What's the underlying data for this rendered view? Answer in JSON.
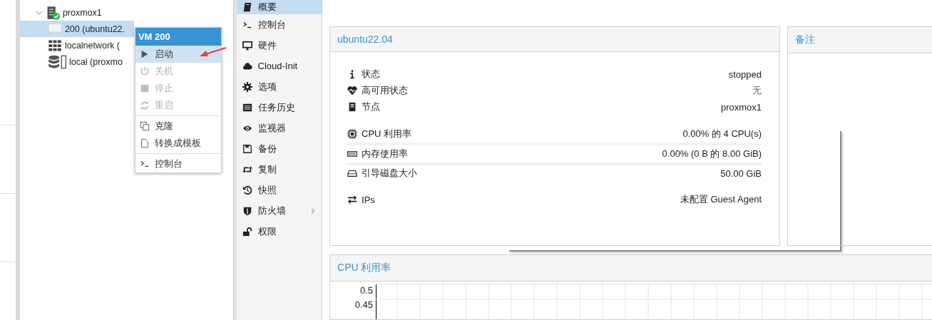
{
  "tree": [
    {
      "label": "proxmox1",
      "kind": "node",
      "expanded": true,
      "selected": false,
      "children": [
        {
          "label": "200 (ubuntu22.",
          "kind": "vm",
          "selected": true
        },
        {
          "label": "localnetwork (",
          "kind": "network",
          "selected": false
        },
        {
          "label": "local (proxmo",
          "kind": "storage",
          "selected": false
        }
      ]
    }
  ],
  "context_menu": {
    "title": "VM 200",
    "items": [
      {
        "kind": "play",
        "label": "启动",
        "disabled": false,
        "selected": true
      },
      {
        "kind": "power",
        "label": "关机",
        "disabled": true,
        "selected": false
      },
      {
        "kind": "stop",
        "label": "停止",
        "disabled": true,
        "selected": false
      },
      {
        "kind": "reload",
        "label": "重启",
        "disabled": true,
        "selected": false
      },
      {
        "kind": "separator"
      },
      {
        "kind": "clone",
        "label": "克隆",
        "disabled": false,
        "selected": false
      },
      {
        "kind": "file",
        "label": "转换成模板",
        "disabled": false,
        "selected": false
      },
      {
        "kind": "separator"
      },
      {
        "kind": "terminal",
        "label": "控制台",
        "disabled": false,
        "selected": false
      }
    ]
  },
  "nav": [
    {
      "label": "概要",
      "selected": true,
      "submenu": false
    },
    {
      "label": "控制台",
      "selected": false,
      "submenu": false
    },
    {
      "label": "硬件",
      "selected": false,
      "submenu": false
    },
    {
      "label": "Cloud-Init",
      "selected": false,
      "submenu": false
    },
    {
      "label": "选项",
      "selected": false,
      "submenu": false
    },
    {
      "label": "任务历史",
      "selected": false,
      "submenu": false
    },
    {
      "label": "监视器",
      "selected": false,
      "submenu": false
    },
    {
      "label": "备份",
      "selected": false,
      "submenu": false
    },
    {
      "label": "复制",
      "selected": false,
      "submenu": false
    },
    {
      "label": "快照",
      "selected": false,
      "submenu": false
    },
    {
      "label": "防火墙",
      "selected": false,
      "submenu": true
    },
    {
      "label": "权限",
      "selected": false,
      "submenu": false
    }
  ],
  "summary": {
    "title": "ubuntu22.04",
    "groups": [
      [
        {
          "kind": "info",
          "label": "状态",
          "value": "stopped",
          "muted": false
        },
        {
          "kind": "heartbeat",
          "label": "高可用状态",
          "value": "无",
          "muted": true
        },
        {
          "kind": "server",
          "label": "节点",
          "value": "proxmox1",
          "muted": false
        }
      ],
      [
        {
          "kind": "chip",
          "label": "CPU 利用率",
          "value": "0.00% 的 4 CPU(s)",
          "muted": false
        },
        {
          "kind": "memory",
          "label": "内存使用率",
          "value": "0.00% (0 B 的 8.00 GiB)",
          "muted": false
        },
        {
          "kind": "disk",
          "label": "引导磁盘大小",
          "value": "50.00 GiB",
          "muted": false
        }
      ],
      [
        {
          "kind": "exchange",
          "label": "IPs",
          "value": "未配置 Guest Agent",
          "muted": false
        }
      ]
    ]
  },
  "notes": {
    "title": "备注"
  },
  "cpu_panel": {
    "title": "CPU 利用率",
    "y_ticks": [
      "0.5",
      "0.45"
    ]
  }
}
